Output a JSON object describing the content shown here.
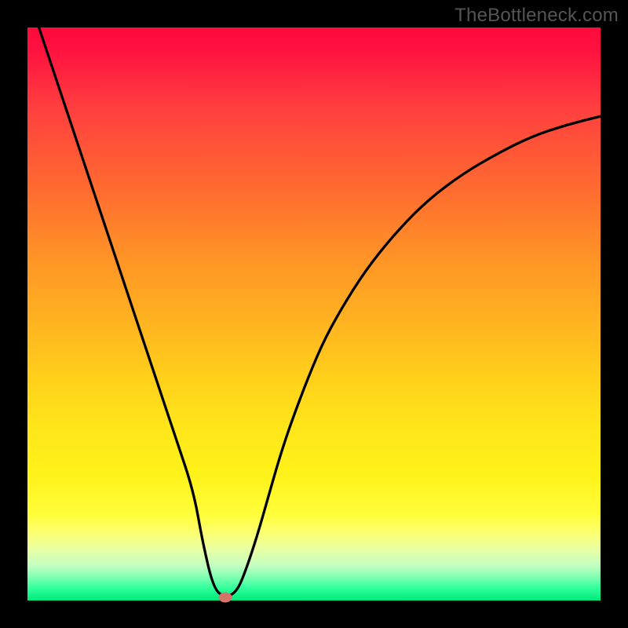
{
  "watermark": "TheBottleneck.com",
  "colors": {
    "frame": "#000000",
    "curve_stroke": "#000000",
    "marker_fill": "#d4756a"
  },
  "chart_data": {
    "type": "line",
    "title": "",
    "xlabel": "",
    "ylabel": "",
    "xlim": [
      0,
      100
    ],
    "ylim": [
      0,
      100
    ],
    "x": [
      2,
      5,
      8,
      11,
      14,
      17,
      20,
      23,
      26,
      29,
      30.6,
      32.5,
      34.5,
      36.5,
      38,
      40,
      42,
      44,
      46,
      49,
      52,
      56,
      60,
      65,
      70,
      76,
      82,
      88,
      94,
      100
    ],
    "values": [
      100,
      91,
      82,
      73,
      64,
      55,
      46,
      37,
      28,
      19,
      10,
      2,
      0.5,
      1.5,
      5,
      11,
      18,
      25,
      31,
      39,
      46,
      53,
      59,
      65,
      70,
      74.5,
      78,
      81,
      83,
      84.5
    ],
    "marker": {
      "x": 34.5,
      "y": 0.5
    },
    "grid": false,
    "legend": false
  }
}
